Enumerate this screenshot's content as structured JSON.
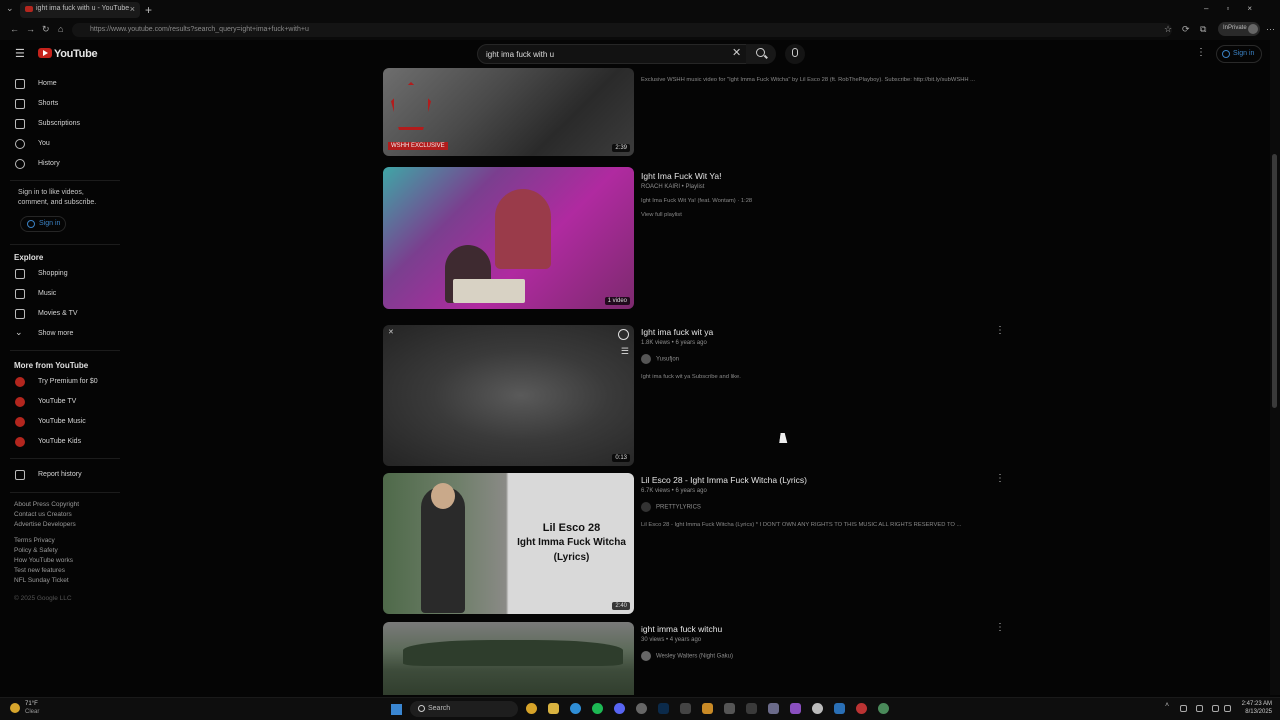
{
  "browser": {
    "tab_title": "ight ima fuck with u - YouTube",
    "new_tab": "+",
    "tab_close": "×",
    "url": "https://www.youtube.com/results?search_query=ight+ima+fuck+with+u",
    "profile_label": "InPrivate"
  },
  "header": {
    "logo_text": "YouTube",
    "search_value": "ight ima fuck with u",
    "signin_label": "Sign in"
  },
  "sidebar": {
    "items": [
      {
        "label": "Home"
      },
      {
        "label": "Shorts"
      },
      {
        "label": "Subscriptions"
      },
      {
        "label": "You"
      },
      {
        "label": "History"
      }
    ],
    "signin_note": "Sign in to like videos, comment, and subscribe.",
    "signin_label": "Sign in",
    "explore_heading": "Explore",
    "explore": [
      {
        "label": "Shopping"
      },
      {
        "label": "Music"
      },
      {
        "label": "Movies & TV"
      },
      {
        "label": "Show more"
      }
    ],
    "more_heading": "More from YouTube",
    "more": [
      {
        "label": "Try Premium for $0"
      },
      {
        "label": "YouTube TV"
      },
      {
        "label": "YouTube Music"
      },
      {
        "label": "YouTube Kids"
      }
    ],
    "report": "Report history",
    "footer1": "About  Press  Copyright",
    "footer2": "Contact us  Creators",
    "footer3": "Advertise  Developers",
    "footer4": "Terms  Privacy",
    "footer5": "Policy & Safety",
    "footer6": "How YouTube works",
    "footer7": "Test new features",
    "footer8": "NFL Sunday Ticket",
    "copyright": "© 2025 Google LLC"
  },
  "results": [
    {
      "description": "Exclusive WSHH music video for \"Ight Imma Fuck Witcha\" by Lil Esco 28 (ft. RobThePlayboy). Subscribe: http://bit.ly/subWSHH ...",
      "duration": "2:39",
      "badge": "WSHH EXCLUSIVE"
    },
    {
      "title": "Ight Ima Fuck Wit Ya!",
      "meta": "ROACH KAIRI • Playlist",
      "desc": "Ight Ima Fuck Wit Ya! (feat. Wontam) · 1:28",
      "link": "View full playlist",
      "duration": "1 video"
    },
    {
      "title": "Ight ima fuck wit ya",
      "meta": "1.8K views • 6 years ago",
      "channel": "Yusufjon",
      "desc": "Ight ima fuck wit ya Subscribe and like.",
      "duration": "0:13"
    },
    {
      "title": "Lil Esco 28 - Ight Imma Fuck Witcha (Lyrics)",
      "meta": "6.7K views • 6 years ago",
      "channel": "PRETTYLYRICS",
      "desc": "Lil Esco 28 - Ight Imma Fuck Witcha (Lyrics) * I DON'T OWN ANY RIGHTS TO THIS MUSIC ALL RIGHTS RESERVED TO ...",
      "duration": "2:40",
      "thumb_text_1": "Lil Esco 28",
      "thumb_text_2": "Ight Imma Fuck Witcha",
      "thumb_text_3": "(Lyrics)"
    },
    {
      "title": "ight imma fuck witchu",
      "meta": "30 views • 4 years ago",
      "channel": "Wesley Walters (Night Gaku)"
    }
  ],
  "taskbar": {
    "weather_temp": "71°F",
    "weather_cond": "Clear",
    "search_label": "Search",
    "time": "2:47:23 AM",
    "date": "8/13/2025"
  },
  "colors": {
    "accent_blue": "#3b82c4",
    "youtube_red": "#c4221b",
    "background": "#050505"
  }
}
